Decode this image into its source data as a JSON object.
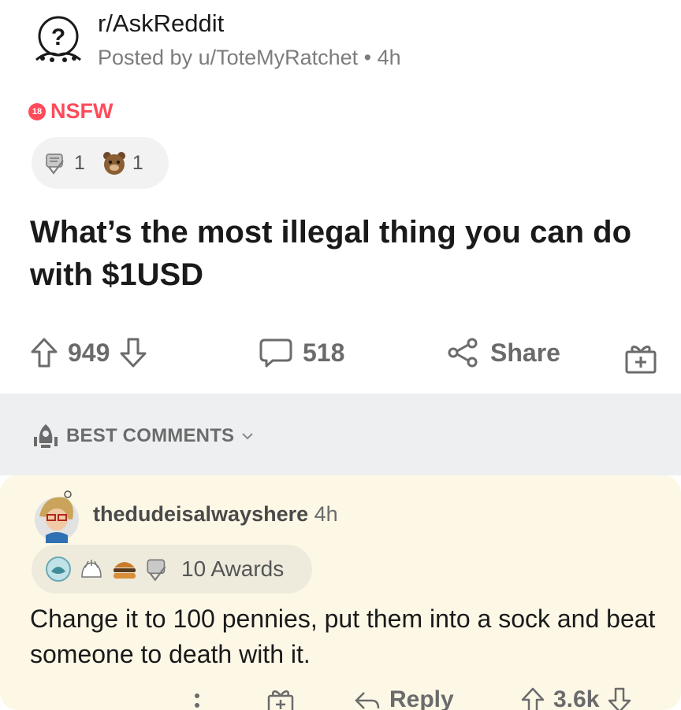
{
  "header": {
    "subreddit": "r/AskReddit",
    "posted_by": "Posted by u/ToteMyRatchet • 4h",
    "subreddit_icon": "askreddit-icon"
  },
  "tags": {
    "nsfw_badge": "18",
    "nsfw_label": "NSFW",
    "nsfw_color": "#ff4a5a"
  },
  "post_awards": [
    {
      "icon": "silver-award-icon",
      "count": "1"
    },
    {
      "icon": "bear-award-icon",
      "count": "1"
    }
  ],
  "post": {
    "title": "What’s the most illegal thing you can do with $1USD"
  },
  "post_actions": {
    "upvotes": "949",
    "comments": "518",
    "share_label": "Share"
  },
  "sort": {
    "label": "BEST COMMENTS"
  },
  "comment": {
    "username": "thedudeisalwayshere",
    "time": "4h",
    "awards_label": "10 Awards",
    "body": "Change it to 100 pennies, put them into a sock and beat someone to death with it.",
    "reply_label": "Reply",
    "score": "3.6k"
  },
  "colors": {
    "section_bg": "#edeff1",
    "comment_bg": "#fdf8e6",
    "muted": "#6b6b6b"
  }
}
